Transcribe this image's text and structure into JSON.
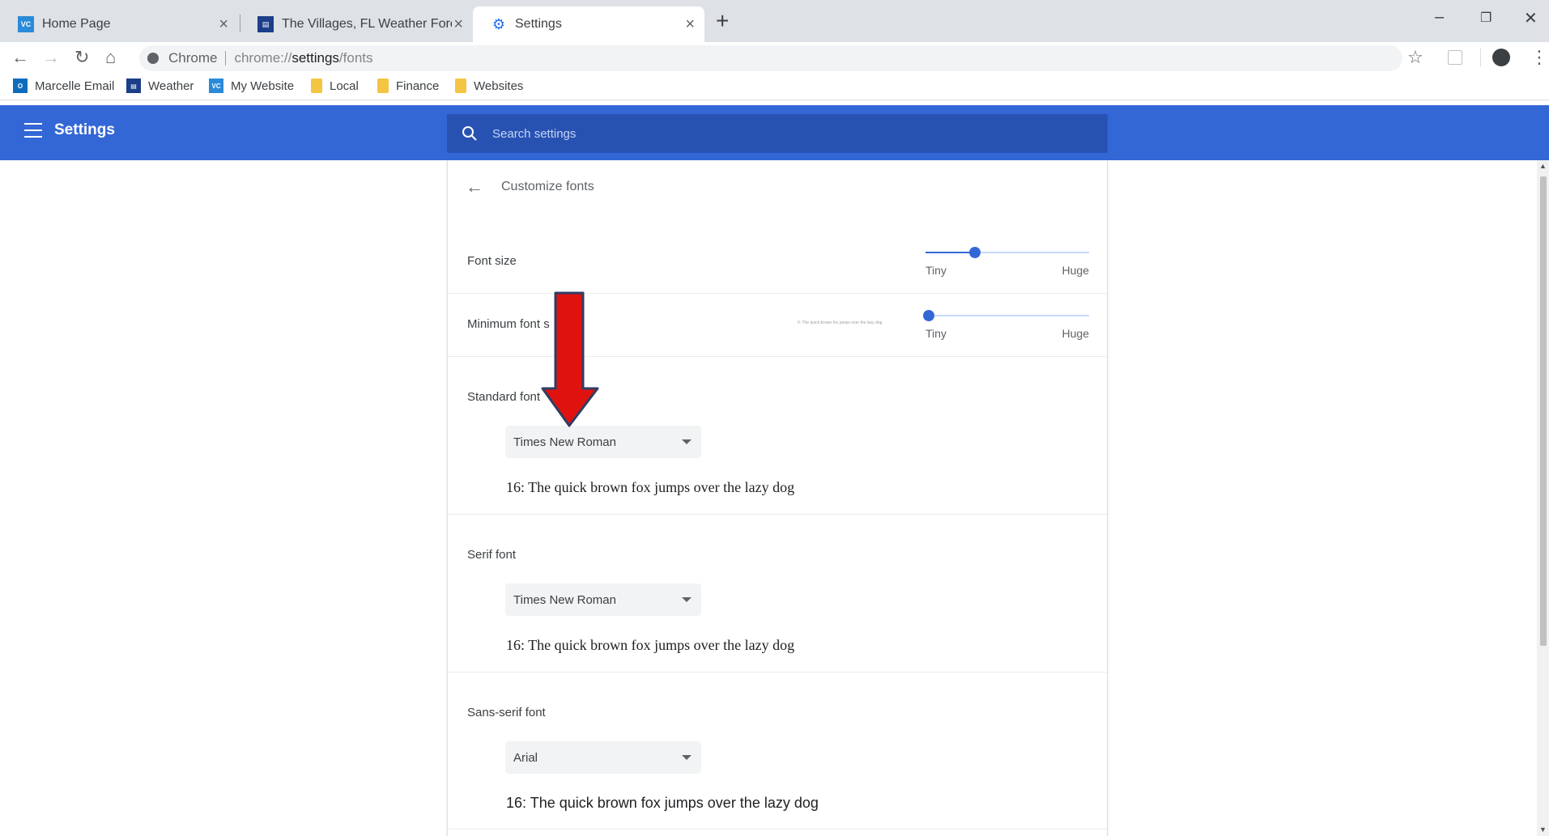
{
  "tabs": [
    {
      "title": "Home Page",
      "favicon": "vc-icon"
    },
    {
      "title": "The Villages, FL Weather Forecas",
      "favicon": "weather-icon"
    },
    {
      "title": "Settings",
      "favicon": "gear-icon"
    }
  ],
  "toolbar": {
    "chrome_label": "Chrome",
    "url_prefix": "chrome://",
    "url_bold": "settings",
    "url_suffix": "/fonts"
  },
  "bookmarks": [
    {
      "label": "Marcelle Email",
      "icon": "outlook-icon"
    },
    {
      "label": "Weather",
      "icon": "weather-icon"
    },
    {
      "label": "My Website",
      "icon": "vc-icon"
    },
    {
      "label": "Local",
      "icon": "folder-icon"
    },
    {
      "label": "Finance",
      "icon": "folder-icon"
    },
    {
      "label": "Websites",
      "icon": "folder-icon"
    }
  ],
  "header": {
    "title": "Settings",
    "search_placeholder": "Search settings"
  },
  "page": {
    "subpage_title": "Customize fonts",
    "font_size": {
      "label": "Font size",
      "min_label": "Tiny",
      "max_label": "Huge",
      "level": 0.3
    },
    "min_font_size": {
      "label": "Minimum font s",
      "min_label": "Tiny",
      "max_label": "Huge",
      "level": 0.0,
      "preview": "0: The quick brown fox jumps over the lazy dog"
    },
    "standard_font": {
      "label": "Standard font",
      "value": "Times New Roman",
      "sample": "16: The quick brown fox jumps over the lazy dog"
    },
    "serif_font": {
      "label": "Serif font",
      "value": "Times New Roman",
      "sample": "16: The quick brown fox jumps over the lazy dog"
    },
    "sans_serif_font": {
      "label": "Sans-serif font",
      "value": "Arial",
      "sample": "16: The quick brown fox jumps over the lazy dog"
    }
  },
  "colors": {
    "header_blue": "#3367d6",
    "annotation_red": "#e0120f"
  }
}
